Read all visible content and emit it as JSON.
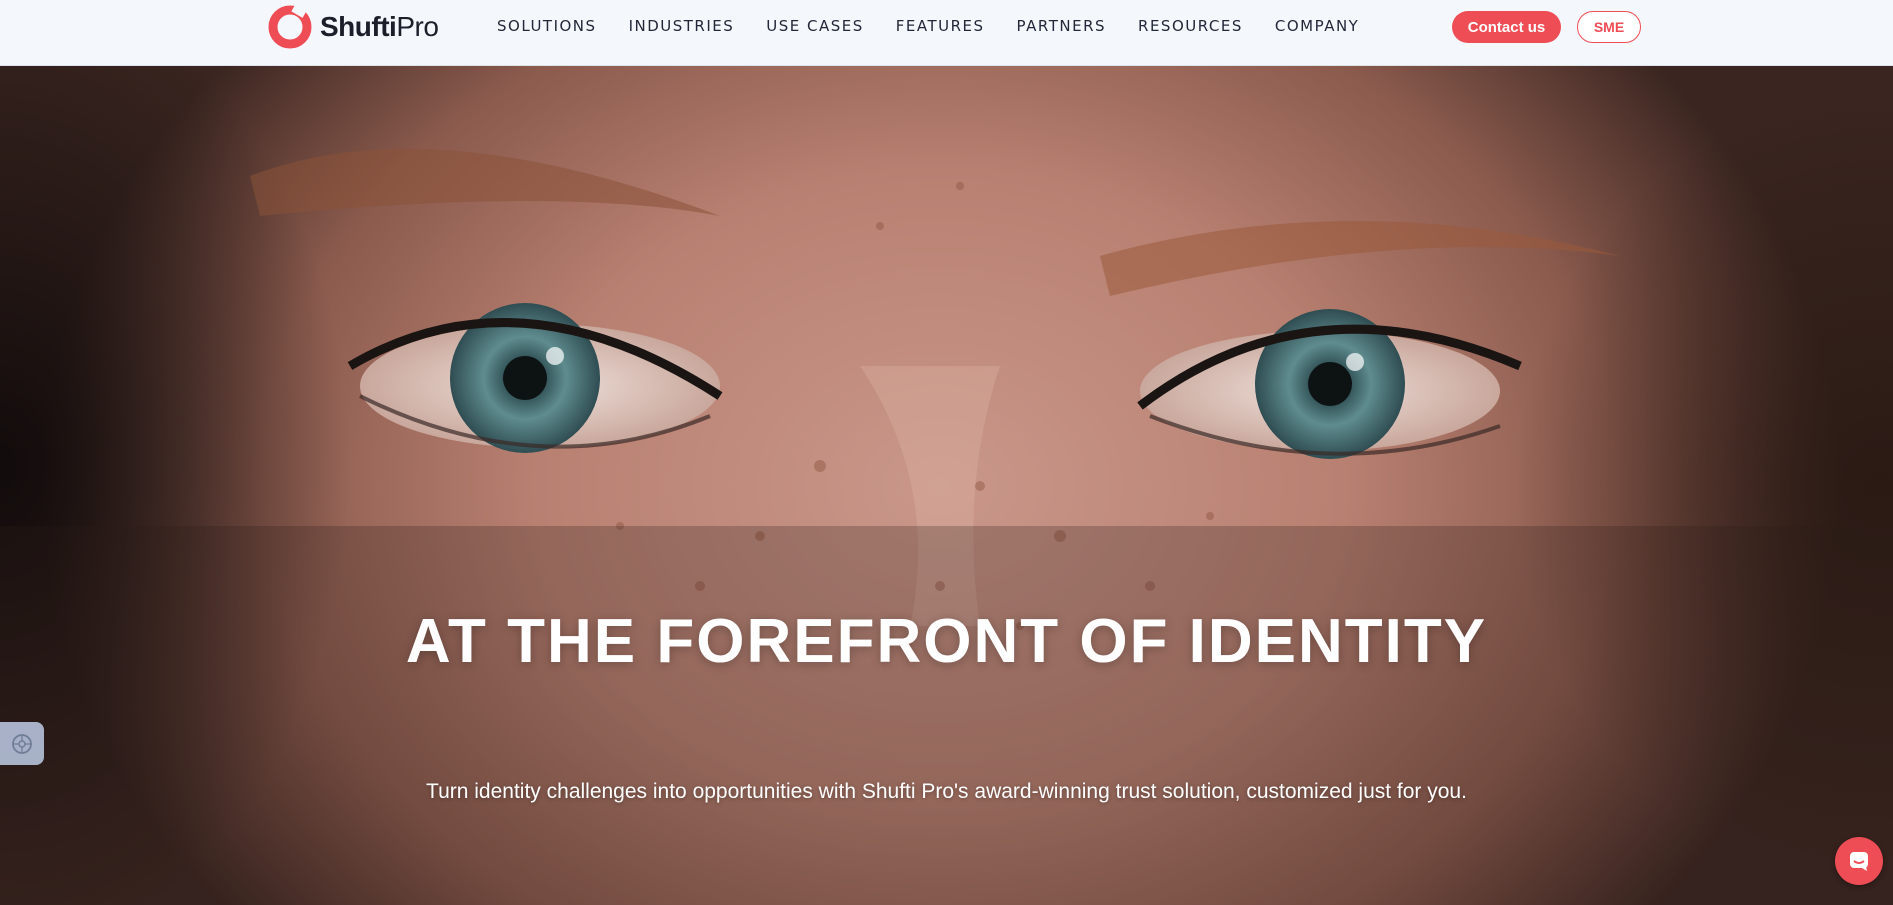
{
  "brand": {
    "name_bold": "Shufti",
    "name_light": "Pro",
    "accent": "#ef4d55"
  },
  "nav": {
    "items": [
      {
        "label": "SOLUTIONS"
      },
      {
        "label": "INDUSTRIES"
      },
      {
        "label": "USE CASES"
      },
      {
        "label": "FEATURES"
      },
      {
        "label": "PARTNERS"
      },
      {
        "label": "RESOURCES"
      },
      {
        "label": "COMPANY"
      }
    ]
  },
  "header": {
    "contact_label": "Contact us",
    "sme_label": "SME"
  },
  "hero": {
    "title": "AT THE FOREFRONT OF IDENTITY",
    "subtitle": "Turn identity challenges into opportunities with Shufti Pro's award-winning trust solution, customized just for you."
  },
  "widgets": {
    "accessibility_icon": "accessibility-icon",
    "chat_icon": "chat-icon"
  }
}
